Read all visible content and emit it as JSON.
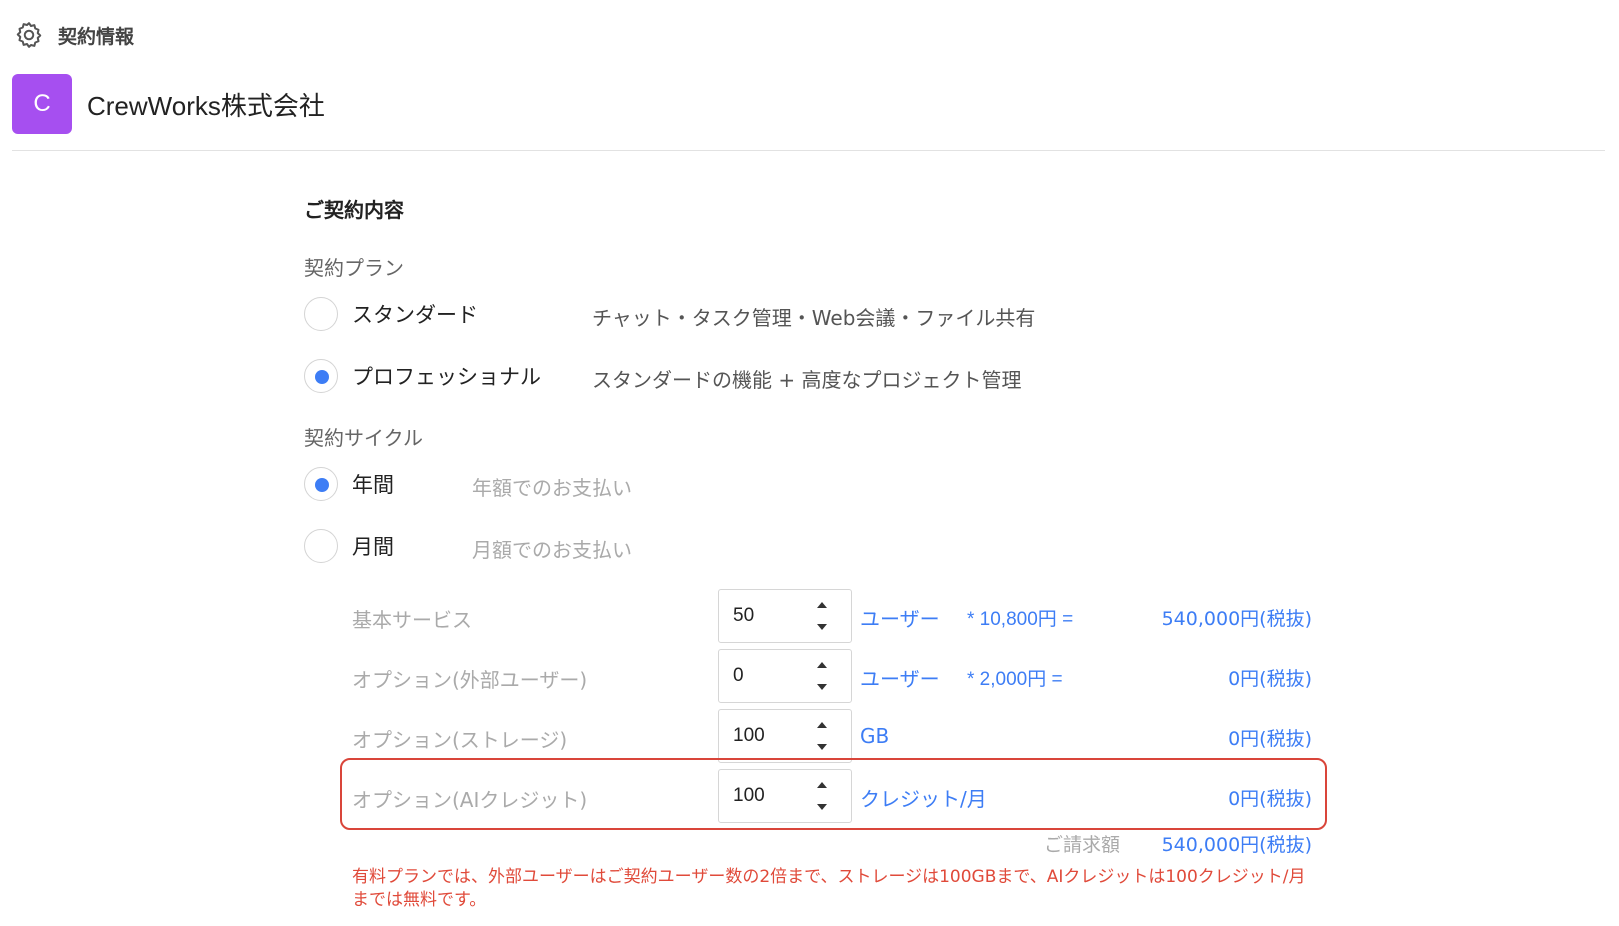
{
  "header": {
    "icon": "gear-icon",
    "title": "契約情報"
  },
  "company": {
    "avatar_letter": "C",
    "avatar_color": "#a64ff0",
    "name": "CrewWorks株式会社"
  },
  "contract": {
    "section_title": "ご契約内容",
    "plan_label": "契約プラン",
    "plans": [
      {
        "label": "スタンダード",
        "description": "チャット・タスク管理・Web会議・ファイル共有",
        "selected": false
      },
      {
        "label": "プロフェッショナル",
        "description": "スタンダードの機能 + 高度なプロジェクト管理",
        "selected": true
      }
    ],
    "cycle_label": "契約サイクル",
    "cycles": [
      {
        "label": "年間",
        "description": "年額でのお支払い",
        "selected": true
      },
      {
        "label": "月間",
        "description": "月額でのお支払い",
        "selected": false
      }
    ]
  },
  "line_items": [
    {
      "label": "基本サービス",
      "value": "50",
      "unit": "ユーザー",
      "rate": "* 10,800円 =",
      "amount": "540,000円(税抜)"
    },
    {
      "label": "オプション(外部ユーザー)",
      "value": "0",
      "unit": "ユーザー",
      "rate": "* 2,000円 =",
      "amount": "0円(税抜)"
    },
    {
      "label": "オプション(ストレージ)",
      "value": "100",
      "unit": "GB",
      "rate": "",
      "amount": "0円(税抜)"
    },
    {
      "label": "オプション(AIクレジット)",
      "value": "100",
      "unit": "クレジット/月",
      "rate": "",
      "amount": "0円(税抜)"
    }
  ],
  "total": {
    "label": "ご請求額",
    "amount": "540,000円(税抜)"
  },
  "note": "有料プランでは、外部ユーザーはご契約ユーザー数の2倍まで、ストレージは100GBまで、AIクレジットは100クレジット/月までは無料です。",
  "colors": {
    "accent": "#3d7df5",
    "highlight_border": "#d9453a",
    "note": "#e04a3a"
  }
}
